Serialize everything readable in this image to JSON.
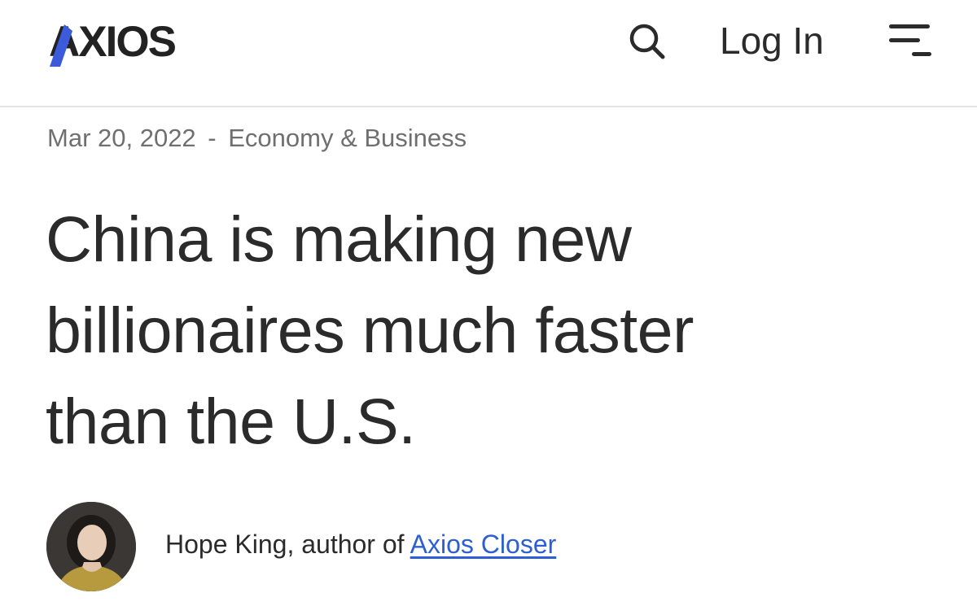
{
  "header": {
    "logo_text": "AXIOS",
    "logo_accent_color": "#3b5bdb",
    "search_icon": "search-icon",
    "login_label": "Log In",
    "menu_icon": "hamburger-menu-icon"
  },
  "article": {
    "date": "Mar 20, 2022",
    "separator": "-",
    "category": "Economy & Business",
    "headline_lines": [
      "China is making new",
      "billionaires much faster",
      "than the U.S."
    ],
    "byline": {
      "author": "Hope King",
      "connector": ", author of ",
      "newsletter": "Axios Closer",
      "link_color": "#2d5fd3"
    }
  }
}
